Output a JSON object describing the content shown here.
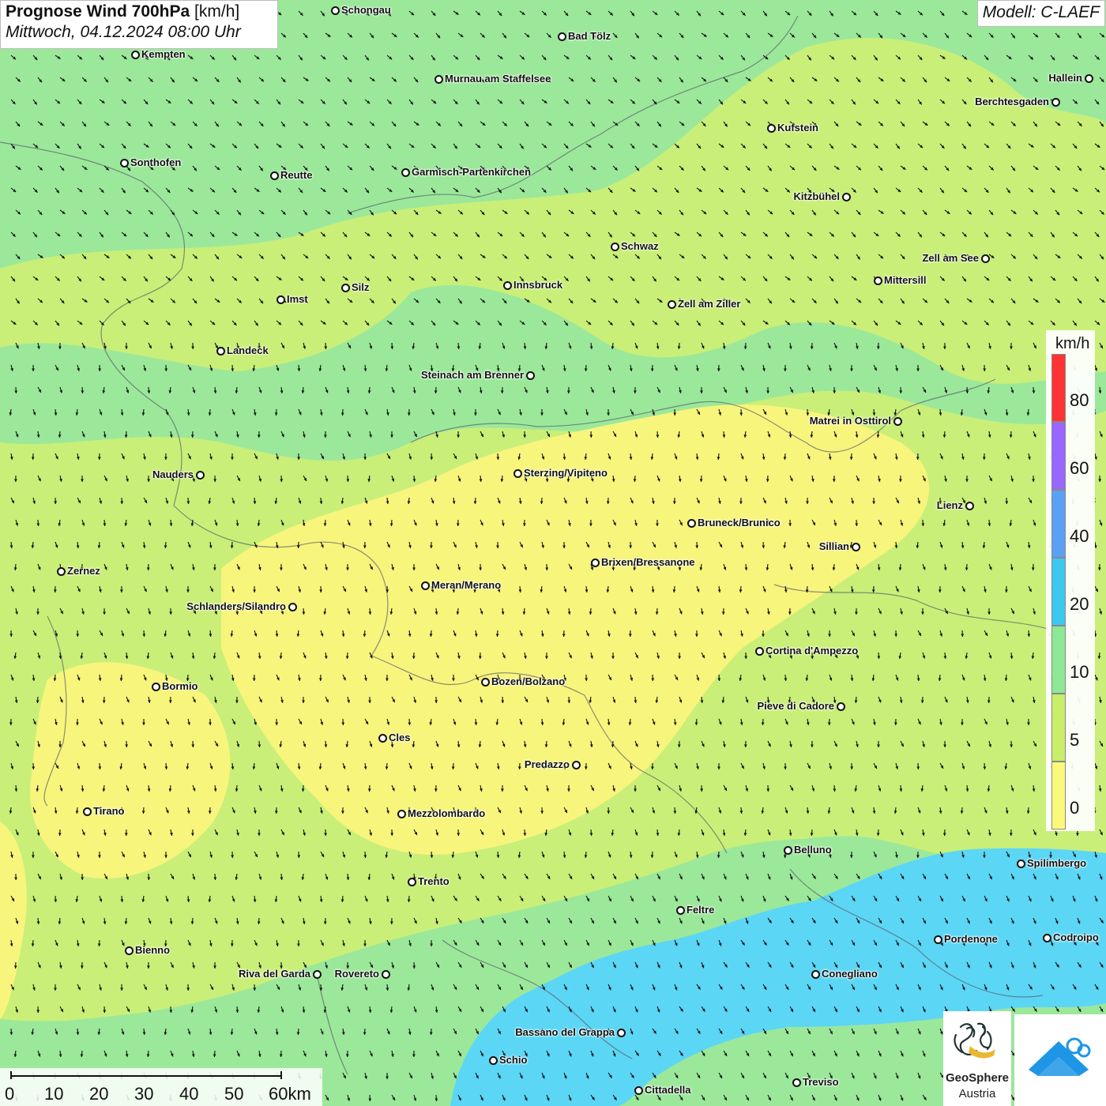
{
  "title": {
    "main_bold": "Prognose Wind 700hPa",
    "main_unit": "[km/h]",
    "subtitle": "Mittwoch, 04.12.2024 08:00 Uhr"
  },
  "model_label": "Modell: C-LAEF",
  "legend": {
    "unit": "km/h",
    "ticks": [
      "80",
      "60",
      "40",
      "20",
      "10",
      "5",
      "0"
    ],
    "colors": [
      "#ff3333",
      "#9966ff",
      "#5aa0f5",
      "#3cc8f0",
      "#8de895",
      "#c8ee6a",
      "#fcf97a"
    ]
  },
  "colors": {
    "calm_yellow": "#f7f57c",
    "light_green": "#c9ef78",
    "green": "#9be89a",
    "blue": "#5cd6f5"
  },
  "cities": [
    {
      "name": "Schongau"
    },
    {
      "name": "Bad Tölz"
    },
    {
      "name": "Kempten"
    },
    {
      "name": "Murnau am Staffelsee"
    },
    {
      "name": "Hallein"
    },
    {
      "name": "Berchtesgaden"
    },
    {
      "name": "Kufstein"
    },
    {
      "name": "Sonthofen"
    },
    {
      "name": "Reutte"
    },
    {
      "name": "Garmisch-Partenkirchen"
    },
    {
      "name": "Kitzbühel"
    },
    {
      "name": "Schwaz"
    },
    {
      "name": "Zell am See"
    },
    {
      "name": "Mittersill"
    },
    {
      "name": "Innsbruck"
    },
    {
      "name": "Silz"
    },
    {
      "name": "Imst"
    },
    {
      "name": "Zell am Ziller"
    },
    {
      "name": "Landeck"
    },
    {
      "name": "Steinach am Brenner"
    },
    {
      "name": "Matrei in Osttirol"
    },
    {
      "name": "Nauders"
    },
    {
      "name": "Sterzing/Vipiteno"
    },
    {
      "name": "Lienz"
    },
    {
      "name": "Bruneck/Brunico"
    },
    {
      "name": "Sillian"
    },
    {
      "name": "Brixen/Bressanone"
    },
    {
      "name": "Zernez"
    },
    {
      "name": "Meran/Merano"
    },
    {
      "name": "Schlanders/Silandro"
    },
    {
      "name": "Cortina d'Ampezzo"
    },
    {
      "name": "Bozen/Bolzano"
    },
    {
      "name": "Bormio"
    },
    {
      "name": "Pieve di Cadore"
    },
    {
      "name": "Cles"
    },
    {
      "name": "Predazzo"
    },
    {
      "name": "Tirano"
    },
    {
      "name": "Mezzolombardo"
    },
    {
      "name": "Belluno"
    },
    {
      "name": "Spilimbergo"
    },
    {
      "name": "Trento"
    },
    {
      "name": "Feltre"
    },
    {
      "name": "Pordenone"
    },
    {
      "name": "Codroipo"
    },
    {
      "name": "Bienno"
    },
    {
      "name": "Riva del Garda"
    },
    {
      "name": "Rovereto"
    },
    {
      "name": "Conegliano"
    },
    {
      "name": "Bassano del Grappa"
    },
    {
      "name": "Schio"
    },
    {
      "name": "Treviso"
    },
    {
      "name": "Cittadella"
    }
  ],
  "scale_bar": {
    "labels": [
      "0",
      "10",
      "20",
      "30",
      "40",
      "50",
      "60km"
    ]
  },
  "logos": {
    "geosphere_line1": "GeoSphere",
    "geosphere_line2": "Austria"
  }
}
